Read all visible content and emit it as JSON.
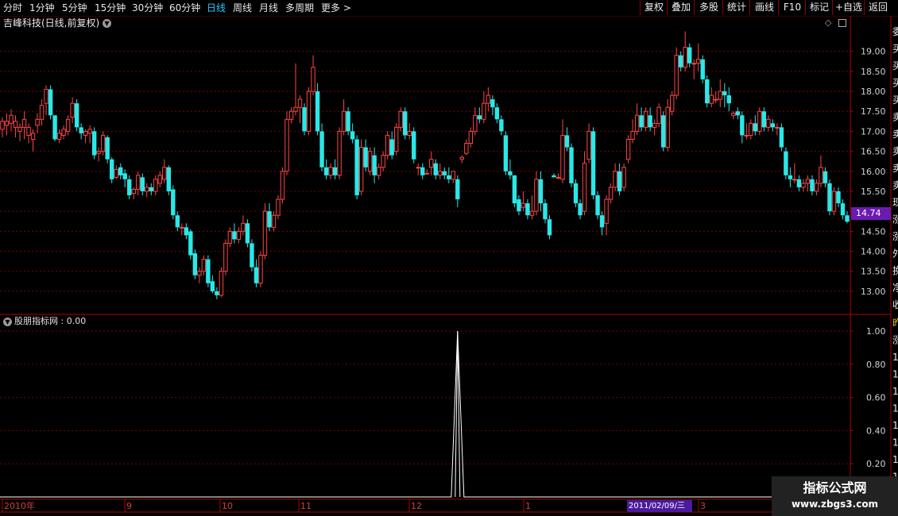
{
  "toolbar": {
    "periods": [
      "分时",
      "1分钟",
      "5分钟",
      "15分钟",
      "30分钟",
      "60分钟",
      "日线",
      "周线",
      "月线",
      "多周期",
      "更多 >"
    ],
    "active": "日线",
    "right_buttons": [
      "复权",
      "叠加",
      "多股",
      "统计",
      "画线",
      "F10",
      "标记",
      "+自选",
      "返回"
    ]
  },
  "chart_title": "吉峰科技(日线,前复权)",
  "indicator_title": "股朋指标网 : 0.00",
  "price_axis": [
    "19.00",
    "18.50",
    "18.00",
    "17.50",
    "17.00",
    "16.50",
    "16.00",
    "15.50",
    "15.00",
    "14.50",
    "14.00",
    "13.50",
    "13.00"
  ],
  "indicator_axis": [
    "1.00",
    "0.80",
    "0.60",
    "0.40",
    "0.20"
  ],
  "current_price": "14.74",
  "time_axis": [
    "2010年",
    "9",
    "10",
    "11",
    "12",
    "1",
    "3"
  ],
  "cursor_date": "2011/02/09/三",
  "right_panel_chars": [
    "委",
    "买",
    "买",
    "买",
    "买",
    "卖",
    "卖",
    "卖",
    "卖",
    "卖",
    "现",
    "涨",
    "涨",
    "外",
    "换",
    "净",
    "收"
  ],
  "right_panel_chars_lower": [
    "昨",
    "涨",
    "1",
    "1",
    "1",
    "1",
    "1",
    "1",
    "1",
    "1",
    "1"
  ],
  "watermark": {
    "title": "指标公式网",
    "url": "www.zbgs3.com"
  },
  "colors": {
    "up": "#ff4545",
    "down": "#29e8e8",
    "grid": "#7a0000",
    "frame": "#b00000",
    "indicator": "#ffffff"
  },
  "chart_data": {
    "type": "candlestick",
    "ylim": [
      12.8,
      19.45
    ],
    "candles": [
      [
        17.05,
        17.35,
        17.25,
        16.85
      ],
      [
        17.15,
        17.45,
        17.25,
        16.9
      ],
      [
        17.2,
        17.55,
        17.4,
        17.0
      ],
      [
        17.1,
        17.4,
        17.25,
        16.85
      ],
      [
        17.0,
        17.2,
        17.1,
        16.75
      ],
      [
        17.1,
        17.5,
        17.3,
        16.8
      ],
      [
        16.9,
        17.2,
        17.1,
        16.7
      ],
      [
        16.8,
        17.05,
        16.95,
        16.5
      ],
      [
        17.15,
        17.45,
        17.3,
        16.95
      ],
      [
        17.3,
        17.8,
        17.65,
        17.15
      ],
      [
        17.7,
        18.15,
        18.05,
        17.4
      ],
      [
        18.05,
        18.15,
        17.4,
        17.3
      ],
      [
        17.4,
        17.4,
        16.8,
        16.75
      ],
      [
        16.8,
        17.05,
        16.95,
        16.7
      ],
      [
        16.9,
        17.15,
        17.05,
        16.8
      ],
      [
        17.0,
        17.4,
        17.3,
        16.9
      ],
      [
        17.35,
        17.85,
        17.7,
        17.2
      ],
      [
        17.7,
        17.8,
        17.1,
        17.0
      ],
      [
        17.1,
        17.2,
        16.95,
        16.8
      ],
      [
        16.9,
        17.05,
        17.0,
        16.7
      ],
      [
        16.95,
        17.15,
        17.05,
        16.7
      ],
      [
        17.0,
        17.1,
        16.4,
        16.3
      ],
      [
        16.45,
        16.6,
        16.5,
        16.25
      ],
      [
        16.5,
        17.0,
        16.9,
        16.4
      ],
      [
        16.85,
        16.9,
        16.3,
        16.2
      ],
      [
        16.3,
        16.35,
        15.8,
        15.7
      ],
      [
        15.85,
        16.15,
        16.05,
        15.8
      ],
      [
        16.1,
        16.2,
        15.9,
        15.8
      ],
      [
        15.95,
        16.05,
        15.8,
        15.6
      ],
      [
        15.8,
        15.9,
        15.4,
        15.3
      ],
      [
        15.45,
        15.6,
        15.55,
        15.3
      ],
      [
        15.55,
        16.0,
        15.9,
        15.4
      ],
      [
        15.85,
        15.95,
        15.5,
        15.4
      ],
      [
        15.5,
        15.7,
        15.6,
        15.35
      ],
      [
        15.6,
        15.7,
        15.5,
        15.4
      ],
      [
        15.5,
        15.9,
        15.8,
        15.4
      ],
      [
        15.7,
        16.0,
        15.9,
        15.6
      ],
      [
        15.8,
        16.3,
        16.1,
        15.7
      ],
      [
        16.1,
        16.15,
        15.5,
        15.4
      ],
      [
        15.55,
        15.65,
        14.9,
        14.8
      ],
      [
        14.9,
        15.0,
        14.6,
        14.5
      ],
      [
        14.6,
        14.7,
        14.6,
        14.4
      ],
      [
        14.6,
        14.7,
        14.4,
        14.3
      ],
      [
        14.5,
        14.55,
        13.9,
        13.8
      ],
      [
        13.95,
        14.05,
        13.4,
        13.3
      ],
      [
        13.4,
        13.6,
        13.5,
        13.2
      ],
      [
        13.5,
        13.9,
        13.8,
        13.4
      ],
      [
        13.8,
        13.9,
        13.2,
        13.1
      ],
      [
        13.25,
        13.4,
        13.0,
        12.95
      ],
      [
        13.0,
        13.1,
        12.9,
        12.8
      ],
      [
        12.9,
        13.6,
        13.5,
        12.85
      ],
      [
        13.5,
        14.3,
        14.2,
        13.4
      ],
      [
        14.2,
        14.6,
        14.5,
        14.1
      ],
      [
        14.5,
        14.7,
        14.3,
        14.2
      ],
      [
        14.3,
        14.6,
        14.5,
        14.2
      ],
      [
        14.5,
        14.9,
        14.7,
        14.4
      ],
      [
        14.7,
        14.8,
        14.2,
        14.1
      ],
      [
        14.2,
        14.3,
        13.6,
        13.5
      ],
      [
        13.6,
        13.8,
        13.2,
        13.1
      ],
      [
        13.2,
        14.0,
        13.9,
        13.1
      ],
      [
        13.9,
        15.2,
        15.0,
        13.8
      ],
      [
        15.0,
        15.2,
        14.6,
        14.5
      ],
      [
        14.6,
        15.0,
        14.9,
        14.5
      ],
      [
        14.9,
        15.4,
        15.3,
        14.8
      ],
      [
        15.3,
        16.1,
        16.0,
        15.2
      ],
      [
        16.0,
        17.5,
        17.3,
        15.9
      ],
      [
        17.3,
        17.6,
        17.5,
        17.2
      ],
      [
        17.5,
        18.7,
        17.6,
        17.4
      ],
      [
        17.6,
        17.9,
        17.8,
        17.2
      ],
      [
        17.6,
        17.7,
        17.0,
        16.9
      ],
      [
        17.0,
        18.1,
        18.0,
        16.9
      ],
      [
        18.0,
        18.9,
        18.6,
        17.9
      ],
      [
        18.0,
        18.2,
        17.0,
        16.9
      ],
      [
        17.0,
        17.2,
        16.1,
        16.0
      ],
      [
        16.1,
        16.3,
        15.9,
        15.8
      ],
      [
        15.9,
        16.2,
        16.1,
        15.8
      ],
      [
        16.1,
        16.3,
        15.9,
        15.8
      ],
      [
        15.9,
        17.1,
        17.0,
        15.8
      ],
      [
        17.0,
        17.8,
        17.5,
        16.9
      ],
      [
        17.5,
        17.6,
        17.0,
        16.9
      ],
      [
        17.0,
        17.2,
        16.8,
        16.7
      ],
      [
        16.8,
        16.9,
        15.4,
        15.3
      ],
      [
        15.5,
        16.8,
        16.6,
        15.4
      ],
      [
        16.6,
        16.8,
        16.1,
        16.0
      ],
      [
        16.0,
        16.6,
        16.5,
        15.9
      ],
      [
        16.4,
        16.6,
        15.9,
        15.7
      ],
      [
        15.9,
        16.2,
        16.1,
        15.8
      ],
      [
        16.1,
        16.5,
        16.4,
        16.0
      ],
      [
        16.4,
        17.0,
        16.9,
        16.3
      ],
      [
        16.8,
        17.0,
        16.4,
        16.3
      ],
      [
        16.5,
        17.2,
        17.1,
        16.4
      ],
      [
        17.1,
        17.6,
        17.5,
        17.0
      ],
      [
        17.5,
        17.6,
        16.9,
        16.8
      ],
      [
        16.9,
        17.2,
        17.0,
        16.8
      ],
      [
        17.0,
        17.1,
        16.3,
        16.2
      ],
      [
        16.1,
        16.2,
        16.1,
        15.9
      ],
      [
        16.1,
        16.2,
        15.9,
        15.8
      ],
      [
        15.95,
        16.05,
        15.95,
        15.95
      ],
      [
        16.1,
        16.5,
        16.3,
        15.9
      ],
      [
        16.2,
        16.3,
        15.9,
        15.8
      ],
      [
        15.9,
        16.2,
        16.0,
        15.8
      ],
      [
        16.0,
        16.1,
        15.9,
        15.8
      ],
      [
        15.9,
        16.1,
        15.8,
        15.7
      ],
      [
        15.8,
        15.9,
        16.0,
        15.7
      ],
      [
        15.8,
        15.9,
        15.3,
        15.1
      ],
      [
        16.3,
        16.4,
        16.35,
        16.2
      ],
      [
        16.45,
        16.8,
        16.7,
        16.4
      ],
      [
        16.7,
        17.1,
        17.0,
        16.6
      ],
      [
        17.0,
        17.6,
        17.4,
        16.9
      ],
      [
        17.4,
        17.6,
        17.3,
        17.2
      ],
      [
        17.3,
        18.0,
        17.7,
        17.2
      ],
      [
        17.7,
        18.1,
        17.9,
        17.5
      ],
      [
        17.8,
        17.9,
        17.6,
        17.4
      ],
      [
        17.6,
        17.7,
        17.3,
        17.2
      ],
      [
        17.3,
        17.4,
        17.0,
        16.9
      ],
      [
        16.9,
        17.0,
        16.0,
        15.9
      ],
      [
        16.0,
        16.3,
        15.9,
        15.8
      ],
      [
        15.9,
        15.9,
        15.2,
        15.1
      ],
      [
        15.3,
        15.4,
        15.0,
        14.9
      ],
      [
        15.1,
        15.5,
        15.2,
        15.0
      ],
      [
        15.2,
        15.3,
        14.9,
        14.8
      ],
      [
        14.9,
        15.4,
        15.0,
        14.8
      ],
      [
        15.0,
        16.0,
        15.8,
        14.9
      ],
      [
        15.8,
        16.0,
        15.2,
        15.0
      ],
      [
        15.2,
        15.3,
        14.8,
        14.7
      ],
      [
        14.8,
        14.9,
        14.4,
        14.3
      ],
      [
        15.9,
        15.95,
        15.85,
        15.85
      ],
      [
        15.85,
        15.95,
        15.85,
        15.8
      ],
      [
        15.8,
        17.3,
        16.9,
        15.7
      ],
      [
        16.9,
        17.1,
        16.6,
        16.5
      ],
      [
        16.6,
        16.7,
        15.7,
        15.6
      ],
      [
        15.7,
        15.8,
        15.2,
        15.1
      ],
      [
        15.2,
        15.3,
        14.9,
        14.8
      ],
      [
        15.0,
        16.5,
        16.2,
        14.9
      ],
      [
        16.3,
        17.2,
        17.0,
        16.2
      ],
      [
        17.0,
        17.1,
        15.4,
        15.3
      ],
      [
        15.4,
        15.5,
        14.9,
        14.8
      ],
      [
        14.9,
        15.0,
        14.6,
        14.4
      ],
      [
        14.7,
        15.4,
        15.3,
        14.4
      ],
      [
        15.3,
        15.7,
        15.6,
        15.2
      ],
      [
        15.6,
        16.2,
        16.0,
        15.5
      ],
      [
        16.0,
        16.2,
        15.5,
        15.4
      ],
      [
        15.6,
        16.2,
        16.1,
        15.5
      ],
      [
        16.3,
        16.9,
        16.8,
        16.2
      ],
      [
        16.8,
        17.3,
        17.0,
        16.7
      ],
      [
        17.0,
        17.7,
        17.4,
        16.9
      ],
      [
        17.4,
        17.6,
        17.1,
        17.0
      ],
      [
        17.1,
        17.6,
        17.5,
        17.0
      ],
      [
        17.4,
        17.6,
        17.1,
        17.0
      ],
      [
        17.1,
        17.3,
        17.2,
        16.9
      ],
      [
        17.2,
        17.7,
        17.6,
        17.1
      ],
      [
        17.4,
        17.5,
        16.6,
        16.5
      ],
      [
        16.6,
        17.8,
        17.6,
        16.5
      ],
      [
        17.5,
        18.0,
        17.9,
        17.4
      ],
      [
        17.9,
        19.1,
        18.9,
        17.8
      ],
      [
        18.9,
        19.0,
        18.6,
        18.5
      ],
      [
        18.6,
        19.5,
        19.1,
        18.5
      ],
      [
        19.1,
        19.2,
        18.7,
        18.6
      ],
      [
        18.7,
        18.8,
        18.7,
        18.3
      ],
      [
        18.7,
        19.2,
        18.8,
        18.5
      ],
      [
        18.8,
        18.9,
        18.3,
        18.2
      ],
      [
        18.3,
        18.4,
        17.7,
        17.6
      ],
      [
        17.7,
        18.1,
        17.9,
        17.6
      ],
      [
        17.8,
        18.0,
        17.8,
        17.7
      ],
      [
        17.8,
        18.3,
        18.0,
        17.6
      ],
      [
        18.0,
        18.2,
        17.9,
        17.6
      ],
      [
        17.9,
        18.1,
        17.7,
        17.5
      ],
      [
        17.4,
        17.5,
        17.45,
        17.3
      ],
      [
        17.5,
        17.6,
        17.4,
        17.3
      ],
      [
        17.4,
        17.5,
        16.9,
        16.7
      ],
      [
        16.9,
        17.2,
        16.9,
        16.8
      ],
      [
        16.9,
        17.3,
        17.2,
        16.8
      ],
      [
        17.2,
        17.4,
        17.0,
        16.9
      ],
      [
        17.0,
        17.6,
        17.5,
        16.9
      ],
      [
        17.5,
        17.6,
        17.1,
        17.0
      ],
      [
        17.1,
        17.4,
        17.3,
        17.0
      ],
      [
        17.2,
        17.3,
        17.1,
        17.0
      ],
      [
        17.1,
        17.2,
        17.1,
        16.9
      ],
      [
        17.1,
        17.2,
        16.6,
        16.5
      ],
      [
        16.5,
        16.6,
        15.9,
        15.8
      ],
      [
        15.9,
        16.1,
        15.8,
        15.6
      ],
      [
        15.8,
        16.2,
        15.8,
        15.7
      ],
      [
        15.8,
        15.9,
        15.6,
        15.5
      ],
      [
        15.6,
        15.8,
        15.7,
        15.5
      ],
      [
        15.7,
        15.9,
        15.8,
        15.5
      ],
      [
        15.8,
        15.9,
        15.5,
        15.4
      ],
      [
        15.5,
        15.8,
        15.7,
        15.4
      ],
      [
        15.7,
        16.4,
        16.1,
        15.6
      ],
      [
        16.0,
        16.1,
        15.7,
        15.6
      ],
      [
        15.7,
        15.8,
        15.0,
        14.9
      ],
      [
        15.0,
        15.6,
        15.5,
        14.9
      ],
      [
        15.5,
        15.6,
        15.2,
        15.1
      ],
      [
        15.2,
        15.3,
        14.9,
        14.8
      ],
      [
        14.9,
        15.0,
        14.74,
        14.7
      ]
    ],
    "indicator": {
      "ylim": [
        0,
        1
      ],
      "spike_index": 104,
      "values_note": "0 everywhere except 1.00 at spike"
    }
  }
}
